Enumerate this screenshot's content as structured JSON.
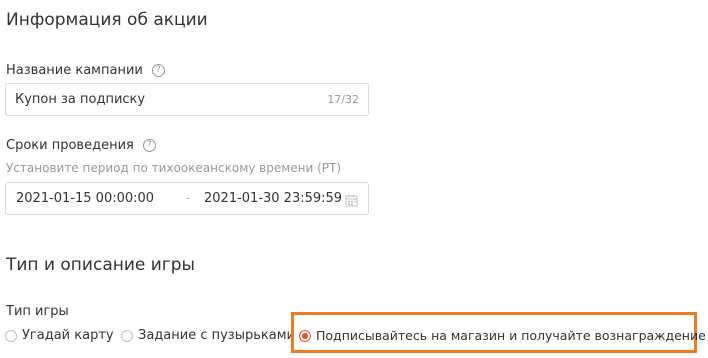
{
  "promo_info": {
    "title": "Информация об акции",
    "campaign_name": {
      "label": "Название кампании",
      "help_icon": "question-circle-icon",
      "value": "Купон за подписку",
      "counter": "17/32"
    },
    "period": {
      "label": "Сроки проведения",
      "help_icon": "question-circle-icon",
      "hint": "Установите период по тихоокеанскому времени (PT)",
      "start": "2021-01-15 00:00:00",
      "separator": "-",
      "end": "2021-01-30 23:59:59",
      "calendar_icon": "calendar-icon"
    }
  },
  "game_info": {
    "title": "Тип и описание игры",
    "type_label": "Тип игры",
    "options": [
      {
        "label": "Угадай карту",
        "selected": false
      },
      {
        "label": "Задание с пузырьками",
        "selected": false
      },
      {
        "label": "Подписывайтесь на магазин и получайте вознаграждение",
        "selected": true
      }
    ],
    "highlight_color": "#f07a22",
    "accent_color": "#ee4d2d"
  }
}
